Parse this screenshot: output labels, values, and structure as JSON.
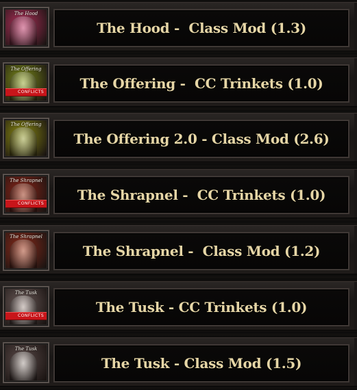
{
  "items": [
    {
      "label": "The Hood -  Class Mod (1.3)",
      "thumb_title": "The Hood",
      "thumb_bg": "#b0305a",
      "thumb_fig": "#e8a8c0",
      "banner": ""
    },
    {
      "label": "The Offering -  CC Trinkets (1.0)",
      "thumb_title": "The Offering",
      "thumb_bg": "#7a8a1a",
      "thumb_fig": "#d8e0a8",
      "banner": "CONFLICTS"
    },
    {
      "label": "The Offering 2.0 - Class Mod (2.6)",
      "thumb_title": "The Offering",
      "thumb_bg": "#8a8a12",
      "thumb_fig": "#d8dcb0",
      "banner": ""
    },
    {
      "label": "The Shrapnel -  CC Trinkets (1.0)",
      "thumb_title": "The Shrapnel",
      "thumb_bg": "#8a2418",
      "thumb_fig": "#d8a898",
      "banner": "CONFLICTS"
    },
    {
      "label": "The Shrapnel -  Class Mod (1.2)",
      "thumb_title": "The Shrapnel",
      "thumb_bg": "#8a2a1a",
      "thumb_fig": "#e0b0a0",
      "banner": ""
    },
    {
      "label": "The Tusk - CC Trinkets (1.0)",
      "thumb_title": "The Tusk",
      "thumb_bg": "#6a5a58",
      "thumb_fig": "#e8e0dc",
      "banner": "CONFLICTS"
    },
    {
      "label": "The Tusk - Class Mod (1.5)",
      "thumb_title": "The Tusk",
      "thumb_bg": "#5a4a48",
      "thumb_fig": "#e8e4e0",
      "banner": ""
    }
  ]
}
